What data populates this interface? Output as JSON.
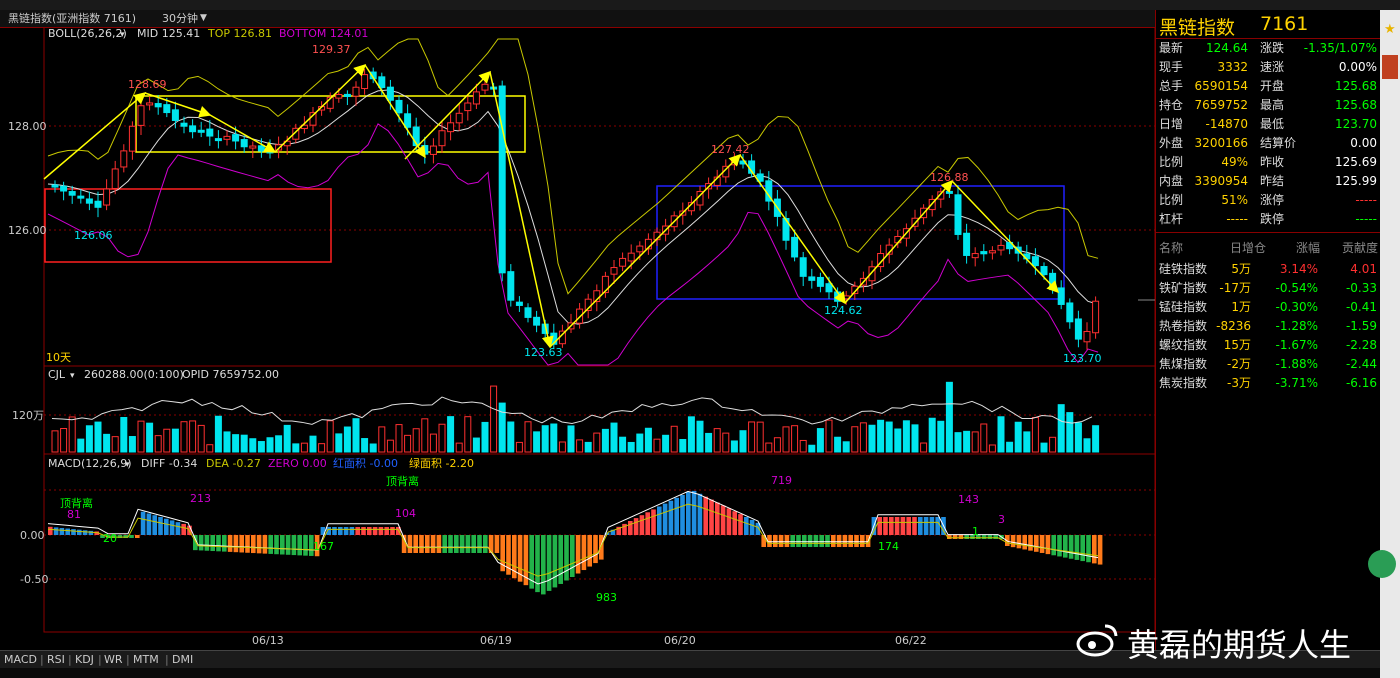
{
  "header": {
    "title": "黑链指数(亚洲指数  7161)",
    "period": "30分钟",
    "dropdown_arrow": "chevron-down-icon"
  },
  "boll": {
    "label": "BOLL(26,26,2)",
    "mid": "MID 125.41",
    "top": "TOP 126.81",
    "bottom": "BOTTOM 124.01"
  },
  "price_axis": [
    "128.00",
    "126.00"
  ],
  "annotations": {
    "hi1": "128.69",
    "hi2": "129.37",
    "lo1": "126.06",
    "lo2": "123.63",
    "hi3": "127.42",
    "lo3": "124.62",
    "hi4": "126.88",
    "lo4": "123.70",
    "days": "10天"
  },
  "volume": {
    "label": "CJL",
    "value": "260288.00(0:100)",
    "opid": "OPID 7659752.00",
    "axis": "120万"
  },
  "macd": {
    "label": "MACD(12,26,9)",
    "diff": "DIFF -0.34",
    "dea": "DEA -0.27",
    "zero": "ZERO 0.00",
    "red_area": "红面积 -0.00",
    "green_area": "绿面积 -2.20",
    "axis": [
      "0.00",
      "-0.50"
    ],
    "notes": {
      "top_div1": "顶背离",
      "top_div2": "顶背离",
      "n81": "81",
      "n213": "213",
      "n20": "20",
      "n104": "104",
      "n167": "167",
      "n719": "719",
      "n983": "983",
      "n143": "143",
      "n174": "174",
      "n1": "1",
      "n3": "3"
    }
  },
  "dates": [
    "06/13",
    "06/19",
    "06/20",
    "06/22"
  ],
  "quote": {
    "title": "黑链指数",
    "code": "7161",
    "rows": [
      {
        "l1": "最新",
        "v1": "124.64",
        "c1": "#00ff00",
        "l2": "涨跌",
        "v2": "-1.35/1.07%",
        "c2": "#00ff00"
      },
      {
        "l1": "现手",
        "v1": "3332",
        "c1": "#ffd200",
        "l2": "速涨",
        "v2": "0.00%",
        "c2": "#ffffff"
      },
      {
        "l1": "总手",
        "v1": "6590154",
        "c1": "#ffd200",
        "l2": "开盘",
        "v2": "125.68",
        "c2": "#00ff00"
      },
      {
        "l1": "持仓",
        "v1": "7659752",
        "c1": "#ffd200",
        "l2": "最高",
        "v2": "125.68",
        "c2": "#00ff00"
      },
      {
        "l1": "日增",
        "v1": "-14870",
        "c1": "#ffd200",
        "l2": "最低",
        "v2": "123.70",
        "c2": "#00ff00"
      },
      {
        "l1": "外盘",
        "v1": "3200166",
        "c1": "#ffd200",
        "l2": "结算价",
        "v2": "0.00",
        "c2": "#ffffff"
      },
      {
        "l1": "比例",
        "v1": "49%",
        "c1": "#ffd200",
        "l2": "昨收",
        "v2": "125.69",
        "c2": "#ffffff"
      },
      {
        "l1": "内盘",
        "v1": "3390954",
        "c1": "#ffd200",
        "l2": "昨结",
        "v2": "125.99",
        "c2": "#ffffff"
      },
      {
        "l1": "比例",
        "v1": "51%",
        "c1": "#ffd200",
        "l2": "涨停",
        "v2": "-----",
        "c2": "#ff3030"
      },
      {
        "l1": "杠杆",
        "v1": "-----",
        "c1": "#ffd200",
        "l2": "跌停",
        "v2": "-----",
        "c2": "#00ff00"
      }
    ]
  },
  "sectors": {
    "head": [
      "名称",
      "日增仓",
      "涨幅",
      "贡献度"
    ],
    "rows": [
      {
        "name": "硅铁指数",
        "inc": "5万",
        "chg": "3.14%",
        "contrib": "4.01",
        "color": "#ff3030"
      },
      {
        "name": "铁矿指数",
        "inc": "-17万",
        "chg": "-0.54%",
        "contrib": "-0.33",
        "color": "#00ff00"
      },
      {
        "name": "锰硅指数",
        "inc": "1万",
        "chg": "-0.30%",
        "contrib": "-0.41",
        "color": "#00ff00"
      },
      {
        "name": "热卷指数",
        "inc": "-8236",
        "chg": "-1.28%",
        "contrib": "-1.59",
        "color": "#00ff00"
      },
      {
        "name": "螺纹指数",
        "inc": "15万",
        "chg": "-1.67%",
        "contrib": "-2.28",
        "color": "#00ff00"
      },
      {
        "name": "焦煤指数",
        "inc": "-2万",
        "chg": "-1.88%",
        "contrib": "-2.44",
        "color": "#00ff00"
      },
      {
        "name": "焦炭指数",
        "inc": "-3万",
        "chg": "-3.71%",
        "contrib": "-6.16",
        "color": "#00ff00"
      }
    ]
  },
  "bottom_tabs": [
    "MACD",
    "RSI",
    "KDJ",
    "WR",
    "MTM",
    "DMI"
  ],
  "watermark": "黄磊的期货人生",
  "colors": {
    "up": "#ff3030",
    "down": "#00e5ee",
    "grid": "#8b0000",
    "boll_mid": "#dddddd",
    "boll_top": "#c8c800",
    "boll_bot": "#d000d0",
    "arrow": "#ffff00"
  }
}
